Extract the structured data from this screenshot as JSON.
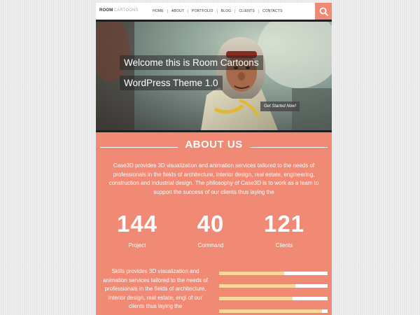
{
  "header": {
    "logo_part1": "ROOM",
    "logo_part2": "CARTOONS",
    "nav": [
      "HOME",
      "ABOUT",
      "PORTFOLIO",
      "BLOG",
      "CLIENTS",
      "CONTACTS"
    ],
    "search_icon": "search-icon"
  },
  "hero": {
    "title_line1": "Welcome this is Room Cartoons",
    "title_line2": "WordPress Theme 1.0",
    "cta": "Get Started Now!"
  },
  "about": {
    "title": "ABOUT US",
    "text": "Case3D provides 3D visualization and animation services tailored to the needs of professionals in the fields of architecture, interior design, real estate, engineering, construction and industrial design. The philosophy of Case3D is to work as a team to support the success of our clients thus laying the"
  },
  "stats": [
    {
      "value": "144",
      "label": "Project"
    },
    {
      "value": "40",
      "label": "Command"
    },
    {
      "value": "121",
      "label": "Clients"
    }
  ],
  "skills": {
    "text": "Skills provides 3D visualization and animation services tailored to the needs of professionals in the fields of architecture, interior design, real estate, engi of our clients thus laying the",
    "bars": [
      {
        "fill": 0.6
      },
      {
        "fill": 0.7
      },
      {
        "fill": 0.68
      },
      {
        "fill": 0.95
      },
      {
        "fill": 0.45
      }
    ]
  },
  "colors": {
    "accent": "#f08a74",
    "bar_fill": "#f8d89a"
  }
}
